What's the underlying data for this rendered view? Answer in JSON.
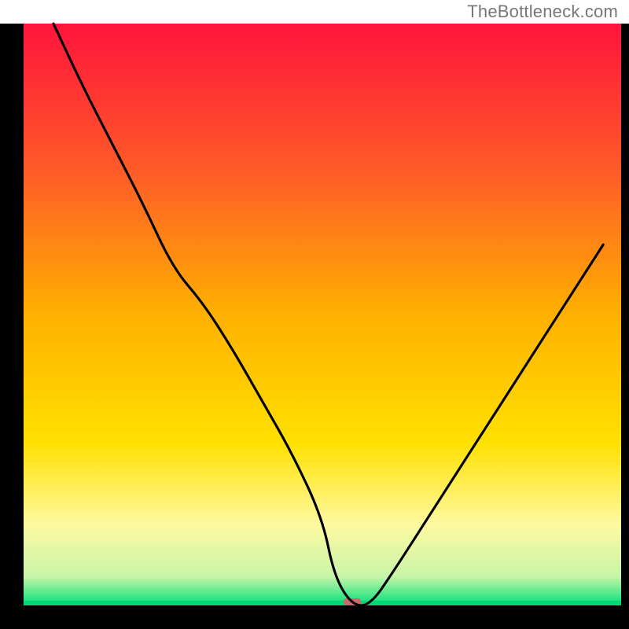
{
  "watermark": "TheBottleneck.com",
  "colors": {
    "black": "#000000",
    "gradient_stops": [
      {
        "offset": 0.0,
        "color": "#ff143c"
      },
      {
        "offset": 0.25,
        "color": "#ff5a28"
      },
      {
        "offset": 0.5,
        "color": "#ffb000"
      },
      {
        "offset": 0.72,
        "color": "#ffe100"
      },
      {
        "offset": 0.86,
        "color": "#fff9a0"
      },
      {
        "offset": 0.95,
        "color": "#c8f5a8"
      },
      {
        "offset": 1.0,
        "color": "#00e07a"
      }
    ],
    "curve": "#000000",
    "marker": "#c86a6a"
  },
  "chart_data": {
    "type": "line",
    "title": "",
    "xlabel": "",
    "ylabel": "",
    "xlim": [
      0,
      100
    ],
    "ylim": [
      0,
      100
    ],
    "optimum_x": 55,
    "marker": {
      "x": 55,
      "y": 0,
      "w": 3,
      "h": 1.2
    },
    "series": [
      {
        "name": "bottleneck-curve",
        "x": [
          5,
          10,
          15,
          20,
          25,
          30,
          35,
          40,
          45,
          50,
          52,
          55,
          58,
          62,
          67,
          72,
          77,
          82,
          87,
          92,
          97
        ],
        "values": [
          100,
          89,
          79,
          69,
          58,
          52,
          44,
          35,
          26,
          15,
          5,
          0,
          0,
          6,
          14,
          22,
          30,
          38,
          46,
          54,
          62
        ]
      }
    ]
  }
}
